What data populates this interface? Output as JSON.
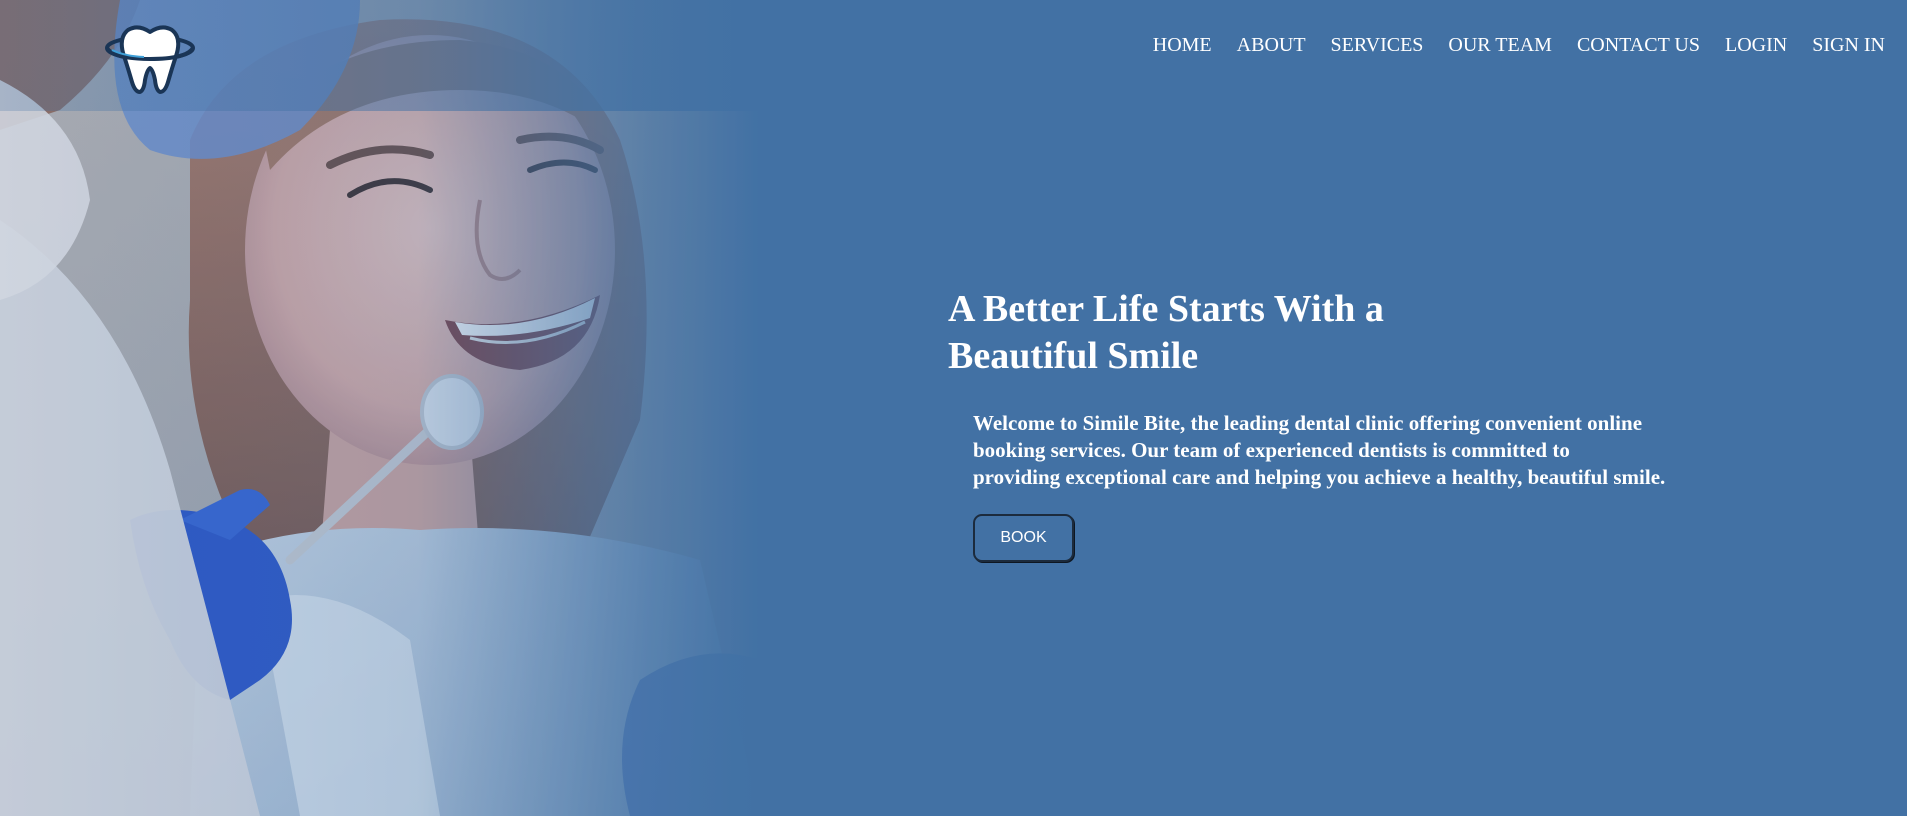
{
  "brand": {
    "logo_icon": "tooth-icon",
    "colors": {
      "background": "#4271a4",
      "text": "#ffffff",
      "button_border": "#1c2b3d"
    }
  },
  "nav": {
    "items": [
      {
        "label": "HOME"
      },
      {
        "label": "ABOUT"
      },
      {
        "label": "SERVICES"
      },
      {
        "label": "OUR TEAM"
      },
      {
        "label": "CONTACT US"
      },
      {
        "label": "LOGIN"
      },
      {
        "label": "SIGN IN"
      }
    ]
  },
  "hero": {
    "title_line1": "A Better Life Starts With a",
    "title_line2": "Beautiful Smile",
    "text_line1": "Welcome to Simile Bite, the leading dental clinic offering convenient online",
    "text_line2": "booking services. Our team of experienced dentists is committed to",
    "text_line3": "providing exceptional care and helping you achieve a healthy, beautiful smile.",
    "button_label": "BOOK",
    "image": "smiling-patient-photo"
  }
}
